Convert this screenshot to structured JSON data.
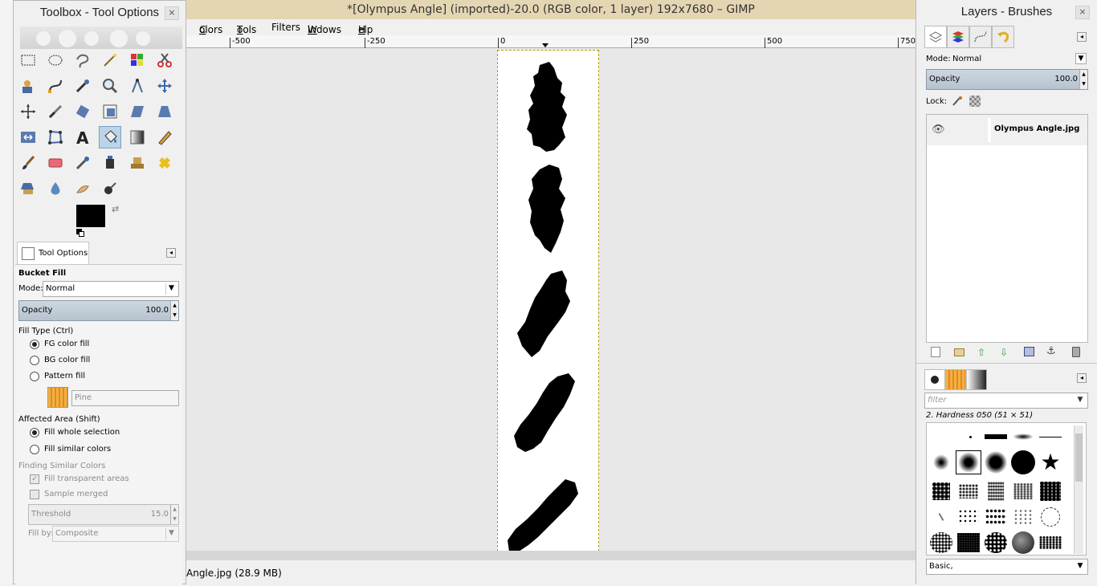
{
  "main_window": {
    "title": "*[Olympus Angle] (imported)-20.0 (RGB color, 1 layer) 192x7680 – GIMP",
    "menu": [
      {
        "label": "Colors",
        "u": "C",
        "rest": "olors"
      },
      {
        "label": "Tools",
        "u": "T",
        "rest": "ools"
      },
      {
        "label": "Filters",
        "u": "",
        "rest": "Filters"
      },
      {
        "label": "Windows",
        "u": "W",
        "rest": "indows"
      },
      {
        "label": "Help",
        "u": "H",
        "rest": "elp"
      }
    ],
    "ruler_ticks": [
      "-500",
      "-250",
      "0",
      "250",
      "500",
      "750"
    ],
    "status_text": "Angle.jpg (28.9 MB)"
  },
  "toolbox": {
    "title": "Toolbox - Tool Options",
    "close": "×",
    "tools": [
      "rect-select-tool",
      "ellipse-select-tool",
      "free-select-tool",
      "fuzzy-select-tool",
      "color-select-tool",
      "scissors-tool",
      "foreground-select-tool",
      "paths-tool",
      "color-picker-tool",
      "zoom-tool",
      "measure-tool",
      "move-tool",
      "align-tool",
      "crop-tool",
      "rotate-tool",
      "scale-tool",
      "shear-tool",
      "perspective-tool",
      "flip-tool",
      "cage-transform-tool",
      "text-tool",
      "bucket-fill-tool",
      "blend-tool",
      "pencil-tool",
      "paintbrush-tool",
      "eraser-tool",
      "airbrush-tool",
      "ink-tool",
      "clone-tool",
      "heal-tool",
      "perspective-clone-tool",
      "blur-tool",
      "smudge-tool",
      "dodge-burn-tool"
    ],
    "active_tool": "bucket-fill-tool",
    "fg_color": "#000000",
    "bg_color": "#ffffff",
    "tab_label": "Tool Options"
  },
  "tool_options": {
    "heading": "Bucket Fill",
    "mode_label": "Mode:",
    "mode_value": "Normal",
    "opacity_label": "Opacity",
    "opacity_value": "100.0",
    "fill_type_label": "Fill Type  (Ctrl)",
    "fill_types": [
      "FG color fill",
      "BG color fill",
      "Pattern fill"
    ],
    "pattern_name": "Pine",
    "affected_label": "Affected Area  (Shift)",
    "affected": [
      "Fill whole selection",
      "Fill similar colors"
    ],
    "similar_label": "Finding Similar Colors",
    "transparent_label": "Fill transparent areas",
    "sample_merged_label": "Sample merged",
    "threshold_label": "Threshold",
    "threshold_value": "15.0",
    "fill_by_label": "Fill by:",
    "fill_by_value": "Composite"
  },
  "layers_window": {
    "title": "Layers - Brushes",
    "close": "×",
    "mode_label": "Mode:",
    "mode_value": "Normal",
    "opacity_label": "Opacity",
    "opacity_value": "100.0",
    "lock_label": "Lock:",
    "layer_name": "Olympus Angle.jpg",
    "filter_placeholder": "filter",
    "brush_name": "2. Hardness 050 (51 × 51)",
    "brush_tag": "Basic,"
  }
}
